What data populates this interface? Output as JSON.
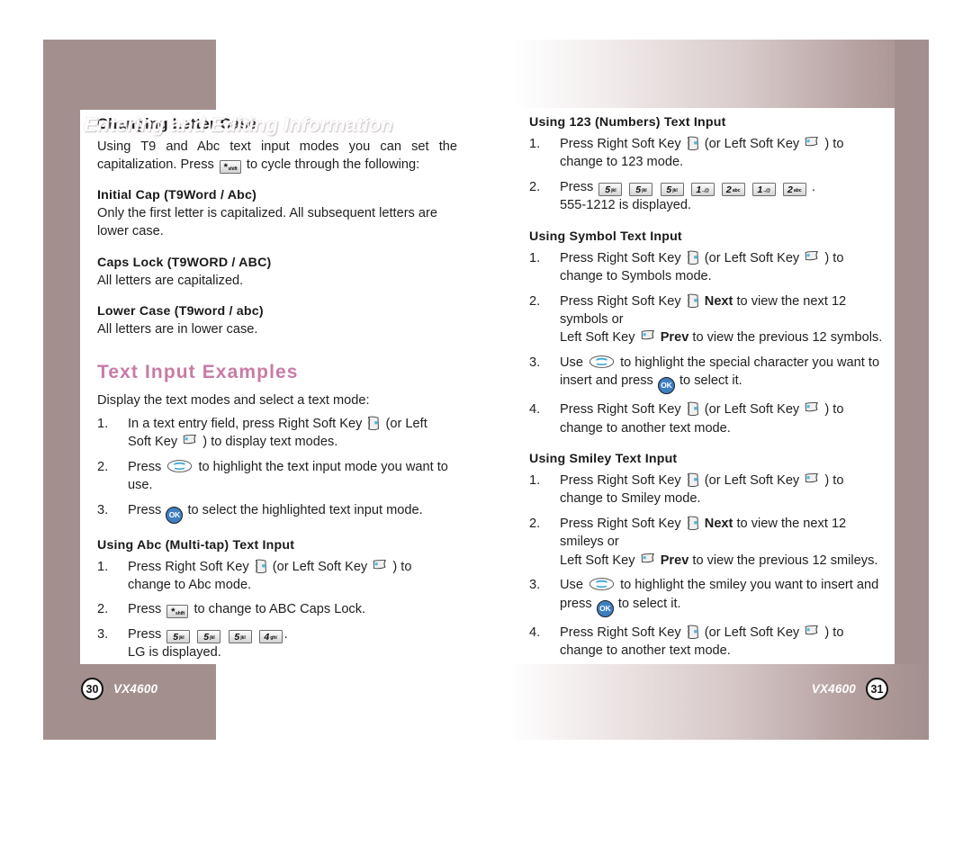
{
  "document": {
    "chapter_title": "Entering and Editing Information",
    "model": "VX4600"
  },
  "left_page": {
    "page_number": "30",
    "model": "VX4600",
    "sections": {
      "changing_letter_case": {
        "heading": "Changing Letter Case",
        "intro_part1": "Using T9 and Abc text input modes you can set the capitalization. Press",
        "intro_part2": "to cycle through the following:",
        "subsections": [
          {
            "heading": "Initial Cap (T9Word / Abc)",
            "body": "Only the first letter is capitalized. All subsequent letters are lower case."
          },
          {
            "heading": "Caps Lock (T9WORD / ABC)",
            "body": "All letters are capitalized."
          },
          {
            "heading": "Lower Case (T9word / abc)",
            "body": "All letters are in lower case."
          }
        ]
      },
      "text_input_examples": {
        "heading": "Text Input Examples",
        "intro": "Display the text modes and select a text mode:",
        "steps": [
          {
            "num": "1.",
            "a": "In a text entry field, press Right Soft Key",
            "b": "(or Left",
            "c": "Soft Key",
            "d": ") to display text modes."
          },
          {
            "num": "2.",
            "a": "Press",
            "b": "to highlight the text input mode you want to use."
          },
          {
            "num": "3.",
            "a": "Press",
            "b": "to select the highlighted text input mode."
          }
        ]
      },
      "using_abc": {
        "heading": "Using Abc (Multi-tap) Text Input",
        "steps": [
          {
            "num": "1.",
            "a": "Press Right Soft Key",
            "b": "(or Left Soft Key",
            "c": ") to change to Abc mode."
          },
          {
            "num": "2.",
            "a": "Press",
            "b": "to change to ABC Caps Lock."
          },
          {
            "num": "3.",
            "a": "Press",
            "b": ".",
            "c": "LG is displayed."
          }
        ]
      }
    }
  },
  "right_page": {
    "page_number": "31",
    "model": "VX4600",
    "sections": {
      "using_123": {
        "heading": "Using 123 (Numbers) Text Input",
        "steps": [
          {
            "num": "1.",
            "a": "Press Right Soft Key",
            "b": "(or Left Soft Key",
            "c": ") to change to 123 mode."
          },
          {
            "num": "2.",
            "a": "Press",
            "b": ".",
            "c": "555-1212 is displayed."
          }
        ]
      },
      "using_symbol": {
        "heading": "Using Symbol Text Input",
        "steps": [
          {
            "num": "1.",
            "a": "Press Right Soft Key",
            "b": "(or Left Soft Key",
            "c": ") to change to Symbols mode."
          },
          {
            "num": "2.",
            "a": "Press Right Soft Key",
            "b": "Next",
            "c": "to view the next 12 symbols or",
            "d": "Left Soft Key",
            "e": "Prev",
            "f": "to view the previous 12 symbols."
          },
          {
            "num": "3.",
            "a": "Use",
            "b": "to highlight the special character you want to insert and press",
            "c": "to select it."
          },
          {
            "num": "4.",
            "a": "Press Right Soft Key",
            "b": "(or Left Soft Key",
            "c": ") to change to another text mode."
          }
        ]
      },
      "using_smiley": {
        "heading": "Using Smiley Text Input",
        "steps": [
          {
            "num": "1.",
            "a": "Press Right Soft Key",
            "b": "(or Left Soft Key",
            "c": ") to change to Smiley mode."
          },
          {
            "num": "2.",
            "a": "Press Right Soft Key",
            "b": "Next",
            "c": "to view the next 12 smileys or",
            "d": "Left Soft Key",
            "e": "Prev",
            "f": "to view the previous 12  smileys."
          },
          {
            "num": "3.",
            "a": "Use",
            "b": "to highlight the smiley you want to insert and press",
            "c": "to select it."
          },
          {
            "num": "4.",
            "a": "Press Right Soft Key",
            "b": "(or Left Soft Key",
            "c": ") to change to another text mode."
          }
        ]
      }
    }
  },
  "keys": {
    "star": {
      "digit": "*",
      "sub": "shift"
    },
    "five": {
      "digit": "5",
      "sub": "jkl"
    },
    "four": {
      "digit": "4",
      "sub": "ghi"
    },
    "one": {
      "digit": "1",
      "sub": ".,@"
    },
    "two": {
      "digit": "2",
      "sub": "abc"
    },
    "ok": "OK"
  },
  "icons": {
    "right_soft_key": "right-soft-key-icon",
    "left_soft_key": "left-soft-key-icon",
    "navigation_key": "navigation-key-icon",
    "ok_key": "ok-key-icon"
  },
  "colors": {
    "mauve": "#a48f8f",
    "pink_heading": "#c87ba6",
    "ok_blue": "#3d7fc1",
    "text": "#1f1f1f"
  }
}
